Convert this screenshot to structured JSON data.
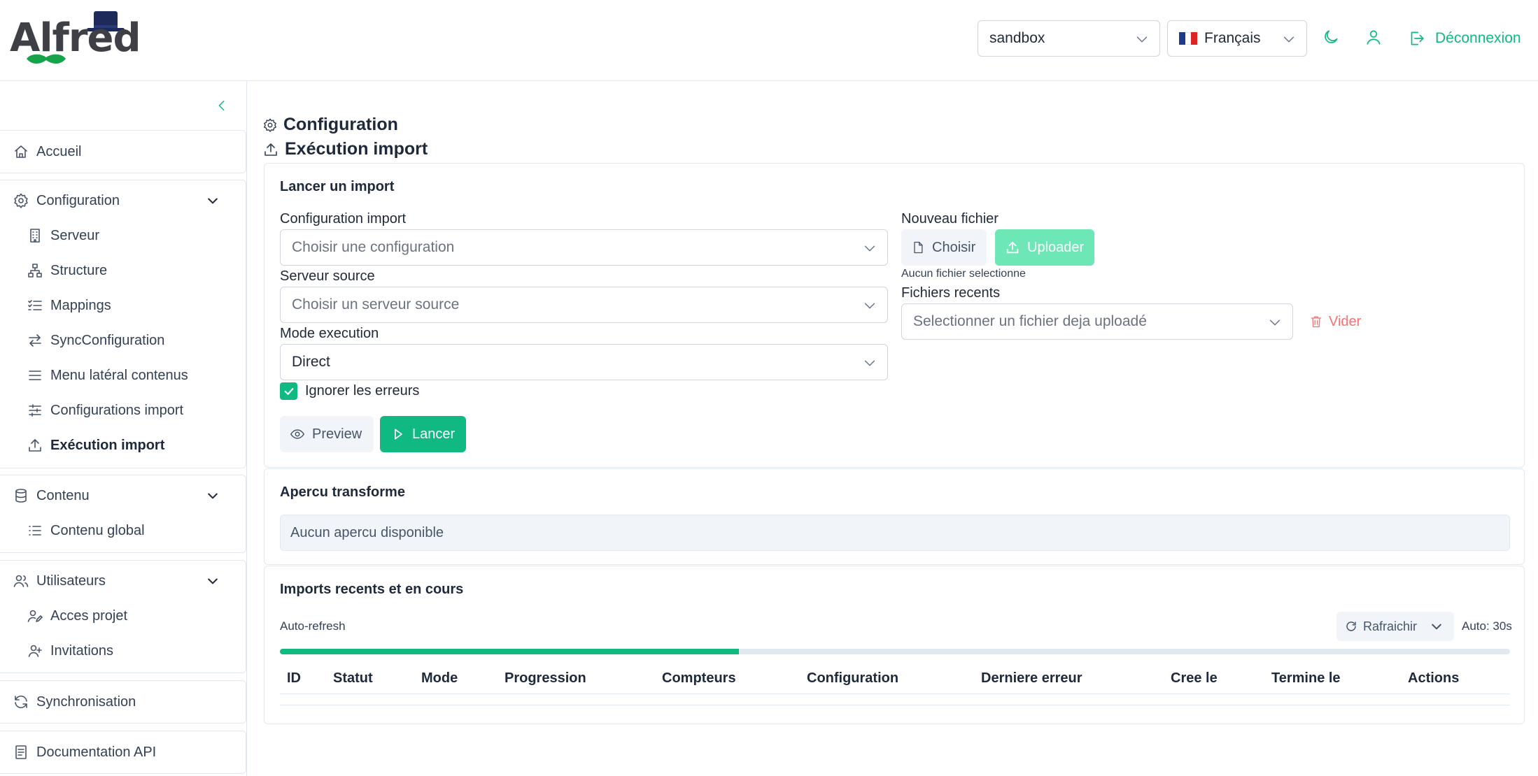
{
  "header": {
    "logo_text": "Alfred",
    "project_select": "sandbox",
    "language": {
      "flag": "🇫🇷",
      "label": "Français"
    },
    "logout_label": "Déconnexion"
  },
  "sidebar": {
    "home": "Accueil",
    "configuration": {
      "label": "Configuration",
      "items": [
        "Serveur",
        "Structure",
        "Mappings",
        "SyncConfiguration",
        "Menu latéral contenus",
        "Configurations import",
        "Exécution import"
      ]
    },
    "content": {
      "label": "Contenu",
      "items": [
        "Contenu global"
      ]
    },
    "users": {
      "label": "Utilisateurs",
      "items": [
        "Acces projet",
        "Invitations"
      ]
    },
    "sync": "Synchronisation",
    "api_docs": "Documentation API"
  },
  "page": {
    "breadcrumb_parent": "Configuration",
    "title": "Exécution import"
  },
  "launch": {
    "title": "Lancer un import",
    "config_label": "Configuration import",
    "config_placeholder": "Choisir une configuration",
    "server_label": "Serveur source",
    "server_placeholder": "Choisir un serveur source",
    "mode_label": "Mode execution",
    "mode_value": "Direct",
    "ignore_errors_label": "Ignorer les erreurs",
    "ignore_errors_checked": true,
    "preview_button": "Preview",
    "launch_button": "Lancer",
    "file_label": "Nouveau fichier",
    "choose_button": "Choisir",
    "upload_button": "Uploader",
    "no_file_text": "Aucun fichier selectionne",
    "recent_label": "Fichiers recents",
    "recent_placeholder": "Selectionner un fichier deja uploadé",
    "clear_button": "Vider"
  },
  "preview": {
    "title": "Apercu transforme",
    "empty_text": "Aucun apercu disponible"
  },
  "imports": {
    "title": "Imports recents et en cours",
    "auto_refresh_label": "Auto-refresh",
    "refresh_button": "Rafraichir",
    "auto_interval": "Auto: 30s",
    "refresh_progress": 0.373,
    "columns": [
      "ID",
      "Statut",
      "Mode",
      "Progression",
      "Compteurs",
      "Configuration",
      "Derniere erreur",
      "Cree le",
      "Termine le",
      "Actions"
    ]
  },
  "colors": {
    "accent": "#10b981",
    "accent_light": "#6ee7b7",
    "danger_light": "#f87171",
    "text": "#334155"
  }
}
